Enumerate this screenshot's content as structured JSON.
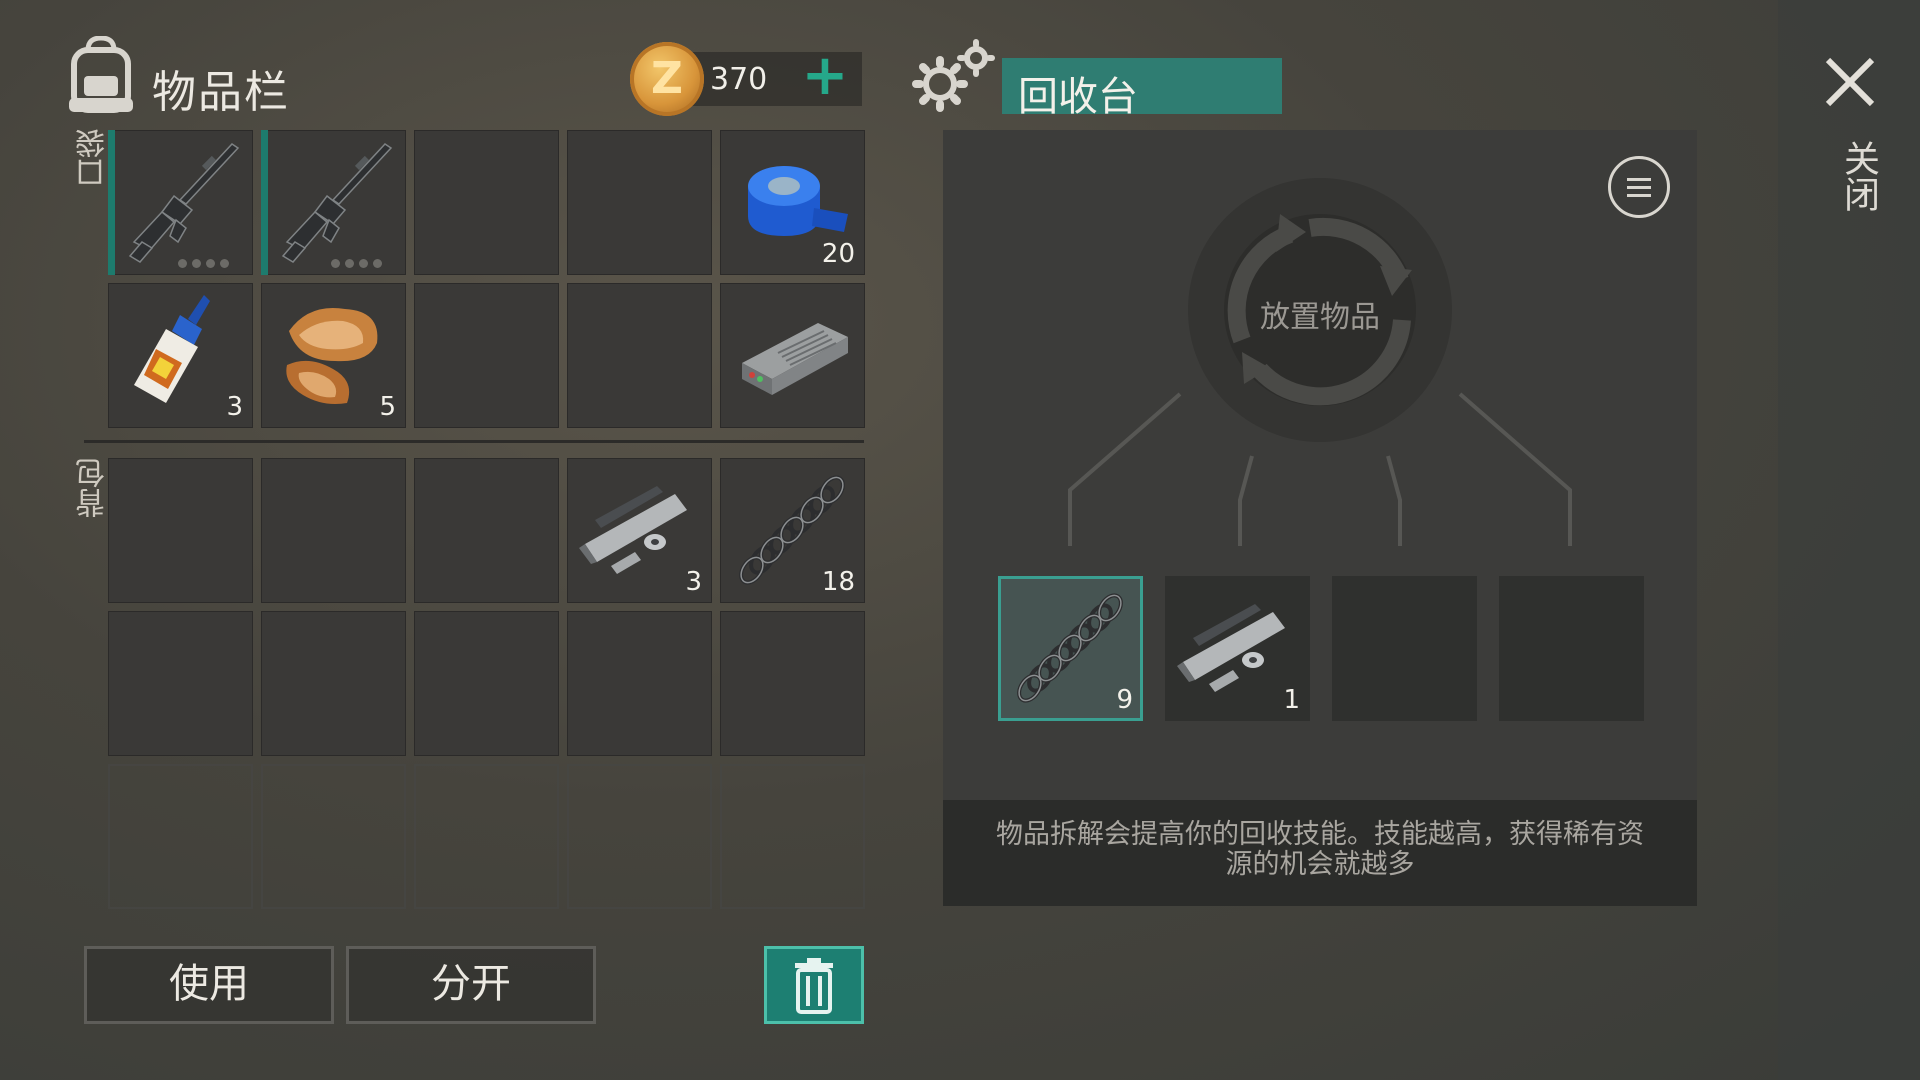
{
  "inventory": {
    "title": "物品栏",
    "coins": {
      "value": "370",
      "add_label": "+"
    },
    "pocket_label": "口袋",
    "backpack_label": "背包",
    "pocket_slots": [
      {
        "item": "assault-rifle",
        "qty": "",
        "equipped": true
      },
      {
        "item": "assault-rifle",
        "qty": "",
        "equipped": true
      },
      {
        "item": "",
        "qty": ""
      },
      {
        "item": "",
        "qty": ""
      },
      {
        "item": "blue-tape",
        "qty": "20"
      },
      {
        "item": "super-glue",
        "qty": "3"
      },
      {
        "item": "fur-pelt",
        "qty": "5"
      },
      {
        "item": "",
        "qty": ""
      },
      {
        "item": "",
        "qty": ""
      },
      {
        "item": "electronic-device",
        "qty": ""
      }
    ],
    "backpack_slots": [
      {
        "item": "",
        "qty": ""
      },
      {
        "item": "",
        "qty": ""
      },
      {
        "item": "",
        "qty": ""
      },
      {
        "item": "gun-parts",
        "qty": "3"
      },
      {
        "item": "spring",
        "qty": "18"
      },
      {
        "item": "",
        "qty": ""
      },
      {
        "item": "",
        "qty": ""
      },
      {
        "item": "",
        "qty": ""
      },
      {
        "item": "",
        "qty": ""
      },
      {
        "item": "",
        "qty": ""
      },
      {
        "item": "",
        "qty": "",
        "locked": true
      },
      {
        "item": "",
        "qty": "",
        "locked": true
      },
      {
        "item": "",
        "qty": "",
        "locked": true
      },
      {
        "item": "",
        "qty": "",
        "locked": true
      },
      {
        "item": "",
        "qty": "",
        "locked": true
      }
    ],
    "buttons": {
      "use": "使用",
      "split": "分开"
    }
  },
  "recycler": {
    "title": "回收台",
    "place_label": "放置物品",
    "outputs": [
      {
        "item": "spring",
        "qty": "9",
        "active": true
      },
      {
        "item": "gun-parts",
        "qty": "1"
      },
      {
        "item": "",
        "qty": ""
      },
      {
        "item": "",
        "qty": ""
      }
    ],
    "info": "物品拆解会提高你的回收技能。技能越高，获得稀有资源的机会就越多"
  },
  "close_label": "关闭",
  "colors": {
    "accent": "#1d7f72",
    "panel": "#3c3c3a"
  }
}
